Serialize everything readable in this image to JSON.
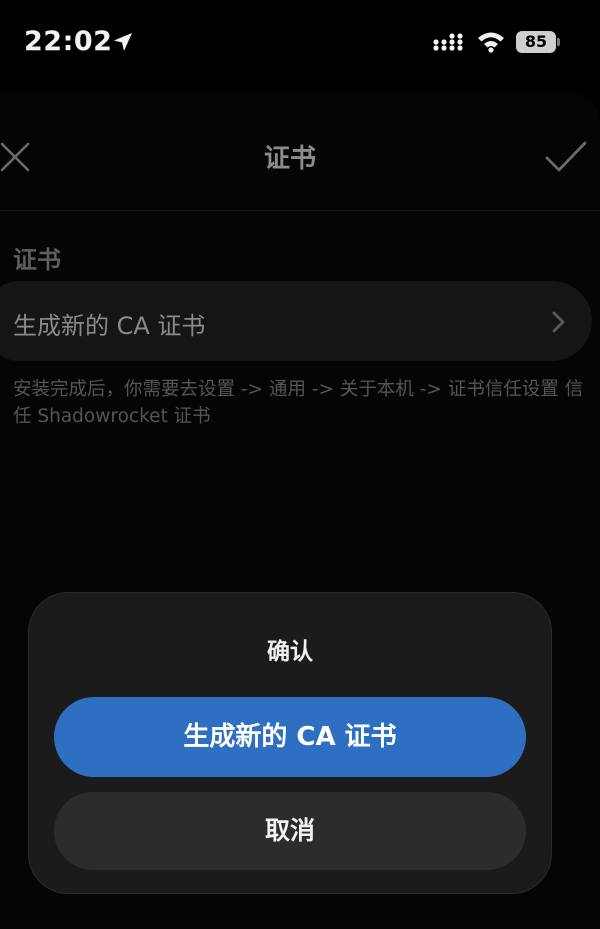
{
  "status_bar": {
    "time": "22:02",
    "battery": "85",
    "icons": [
      "location-arrow-icon",
      "cellular-signal-icon",
      "wifi-icon",
      "battery-icon"
    ]
  },
  "nav": {
    "title": "证书",
    "left_icon": "close-icon",
    "right_icon": "checkmark-icon"
  },
  "section": {
    "header": "证书",
    "cell_label": "生成新的 CA 证书",
    "cell_icon": "chevron-right-icon",
    "footnote": "安装完成后，你需要去设置 -> 通用 -> 关于本机 -> 证书信任设置 信任 Shadowrocket 证书"
  },
  "alert": {
    "title": "确认",
    "primary_label": "生成新的 CA 证书",
    "cancel_label": "取消"
  },
  "colors": {
    "primary_button": "#2e6fc1",
    "alert_background": "#1b1b1c",
    "cancel_button": "#2c2c2e",
    "background": "#000000"
  }
}
